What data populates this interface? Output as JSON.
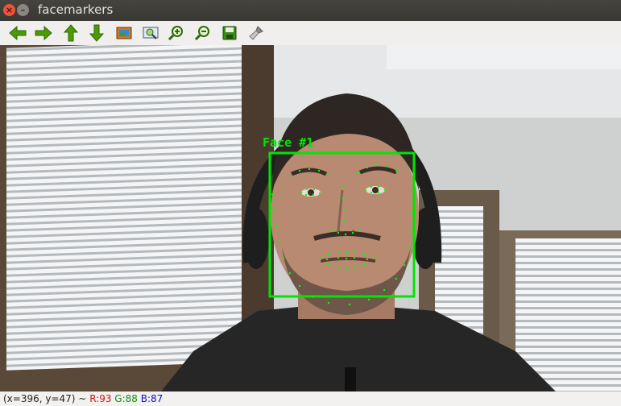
{
  "window": {
    "title": "facemarkers"
  },
  "toolbar": {
    "buttons": [
      {
        "name": "left-arrow-icon",
        "label": "pan left"
      },
      {
        "name": "right-arrow-icon",
        "label": "pan right"
      },
      {
        "name": "up-arrow-icon",
        "label": "pan up"
      },
      {
        "name": "down-arrow-icon",
        "label": "pan down"
      },
      {
        "name": "fit-image-icon",
        "label": "zoom to original"
      },
      {
        "name": "zoom-select-icon",
        "label": "zoom region"
      },
      {
        "name": "zoom-in-icon",
        "label": "zoom in"
      },
      {
        "name": "zoom-out-icon",
        "label": "zoom out"
      },
      {
        "name": "save-icon",
        "label": "save"
      },
      {
        "name": "properties-brush-icon",
        "label": "properties"
      }
    ]
  },
  "overlay": {
    "face_label": "Face #1",
    "box_color": "#00e600",
    "marker_color": "#00e600"
  },
  "status": {
    "coords": "(x=396, y=47) ~",
    "r": "R:93",
    "g": "G:88",
    "b": "B:87"
  }
}
